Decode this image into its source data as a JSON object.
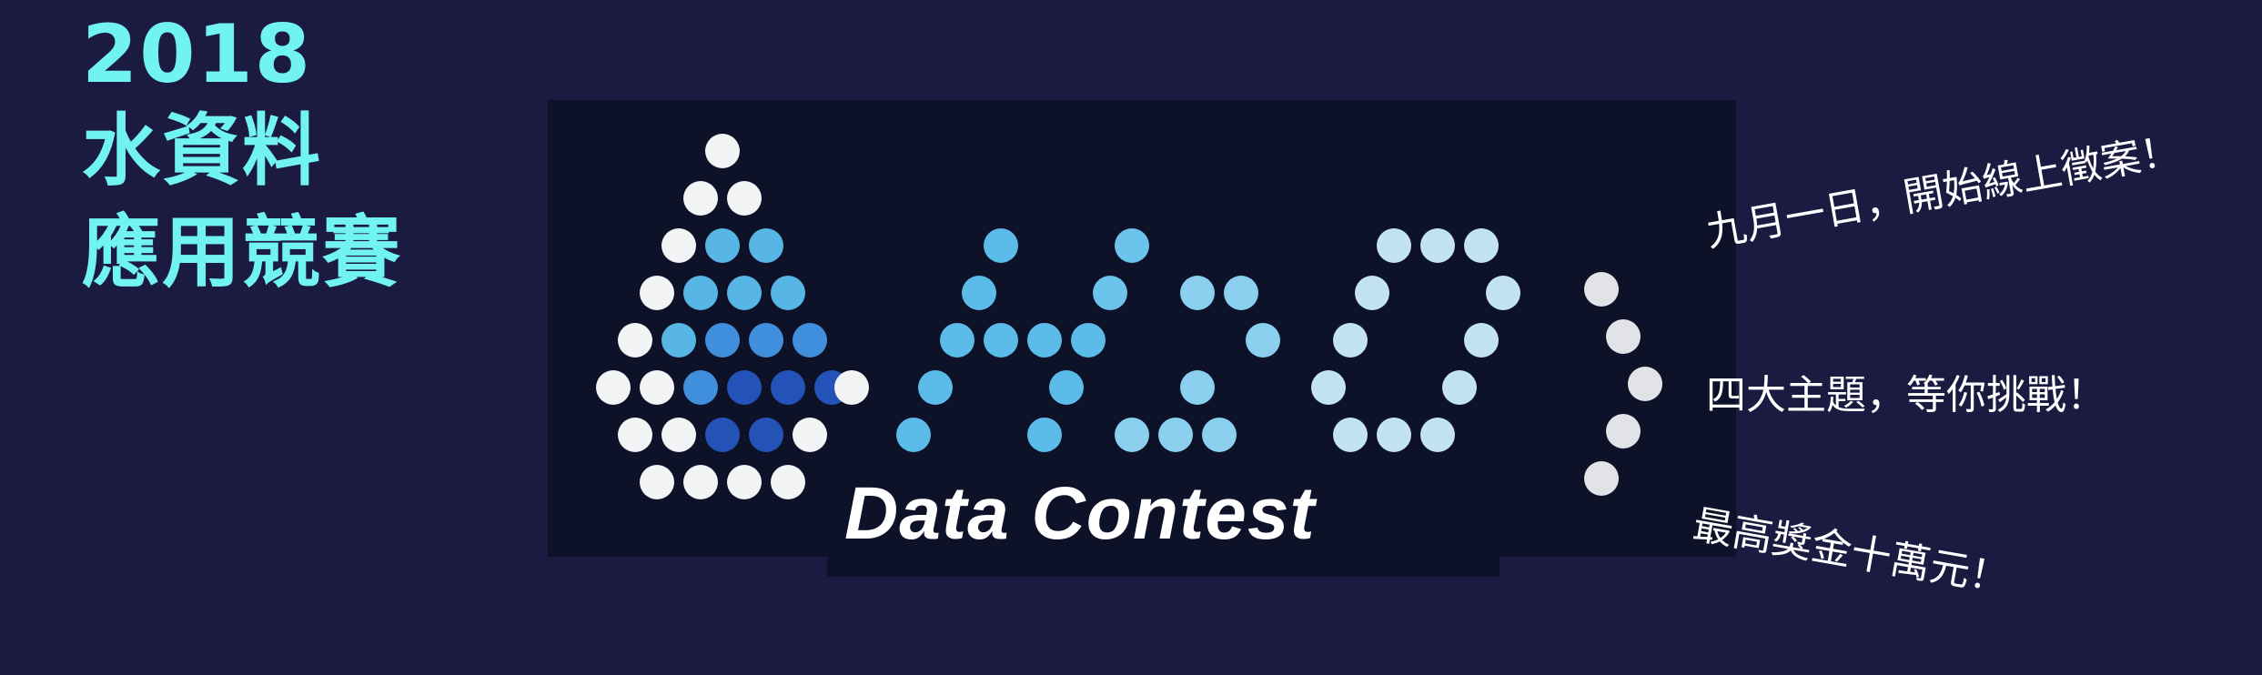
{
  "headline": {
    "year": "2018",
    "line1": "水資料",
    "line2": "應用競賽"
  },
  "logo": {
    "subtitle": "Data Contest"
  },
  "slogans": [
    "九月一日，開始線上徵案！",
    "四大主題，等你挑戰！",
    "最高獎金十萬元！"
  ]
}
